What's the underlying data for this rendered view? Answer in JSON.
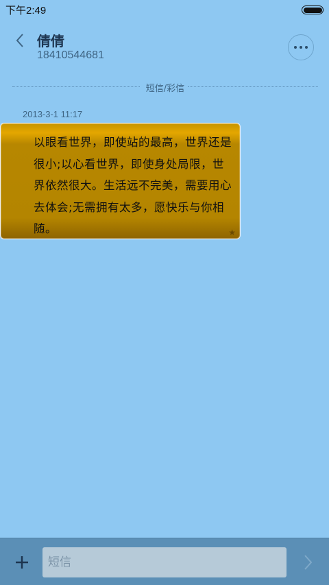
{
  "status_bar": {
    "time": "下午2:49",
    "battery_icon": "battery-full-icon"
  },
  "header": {
    "back_icon": "chevron-left-icon",
    "contact_name": "倩倩",
    "contact_number": "18410544681",
    "more_icon": "more-horizontal-icon"
  },
  "thread": {
    "divider_label": "短信/彩信",
    "messages": [
      {
        "timestamp": "2013-3-1 11:17",
        "text": "以眼看世界，即使站的最高，世界还是很小;以心看世界，即使身处局限，世界依然很大。生活远不完美，需要用心去体会;无需拥有太多，愿快乐与你相随。",
        "starred_icon": "star-icon"
      }
    ]
  },
  "composer": {
    "add_icon": "plus-icon",
    "placeholder": "短信",
    "value": "",
    "send_icon": "send-chevron-icon"
  },
  "colors": {
    "background": "#8ec8f2",
    "bubble": "#b48500",
    "input_bar": "#5b8fb6"
  }
}
